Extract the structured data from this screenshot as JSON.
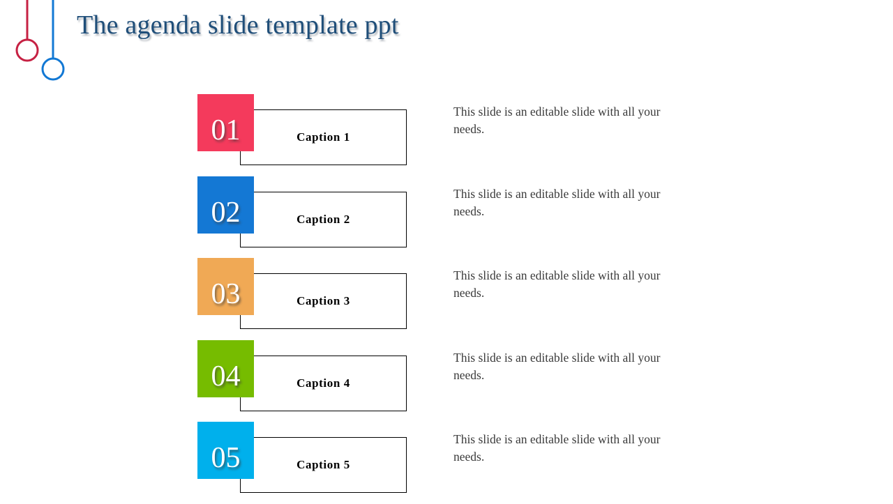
{
  "slide": {
    "title": "The agenda slide template ppt",
    "title_color": "#1f4e79",
    "background_color": "#ffffff"
  },
  "decoration": {
    "pin_red": {
      "name": "red-pin",
      "color": "#C62143"
    },
    "pin_blue": {
      "name": "blue-pin",
      "color": "#1278D4"
    }
  },
  "agenda": {
    "items": [
      {
        "number": "01",
        "color": "#F43A5C",
        "caption": "Caption 1",
        "description": "This slide is an editable slide with all your needs."
      },
      {
        "number": "02",
        "color": "#1478D4",
        "caption": "Caption 2",
        "description": "This slide is an editable slide with all your needs."
      },
      {
        "number": "03",
        "color": "#F0A955",
        "caption": "Caption 3",
        "description": "This slide is an editable slide with all your needs."
      },
      {
        "number": "04",
        "color": "#76BC00",
        "caption": "Caption 4",
        "description": "This slide is an editable slide with all your needs."
      },
      {
        "number": "05",
        "color": "#00B0EC",
        "caption": "Caption 5",
        "description": "This slide is an editable slide with all your needs."
      }
    ]
  }
}
